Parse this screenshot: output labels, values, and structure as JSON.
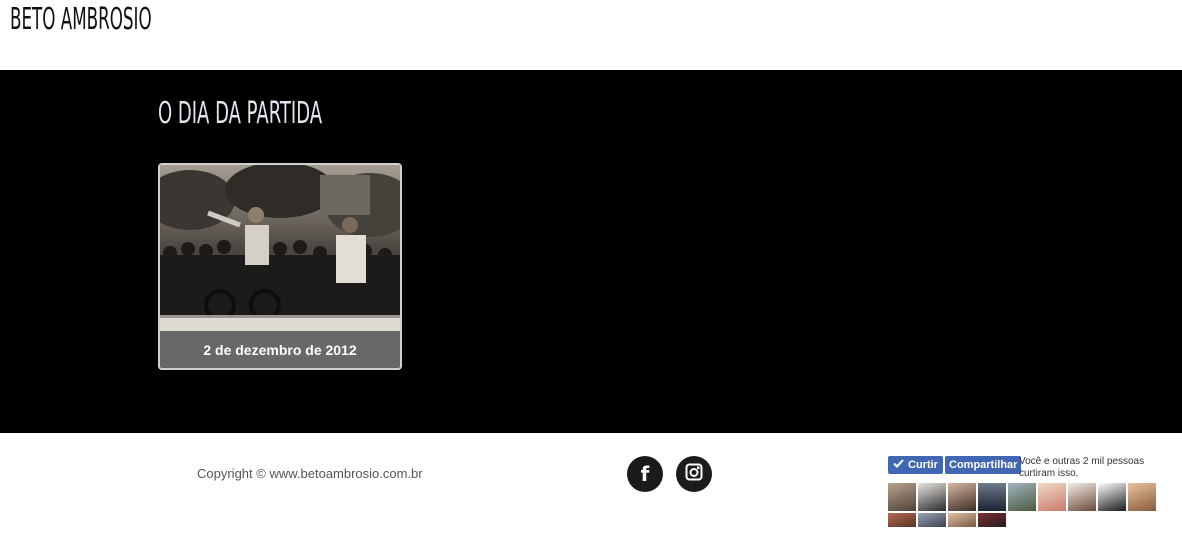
{
  "header": {
    "logo": "BETO AMBROSIO"
  },
  "main": {
    "title": "O DIA DA PARTIDA",
    "gallery": [
      {
        "caption": "2 de dezembro de 2012"
      }
    ]
  },
  "footer": {
    "copyright": "Copyright © www.betoambrosio.com.br",
    "social": [
      {
        "icon": "facebook-icon",
        "glyph": "f"
      },
      {
        "icon": "instagram-icon"
      }
    ],
    "facebook_widget": {
      "like_label": "Curtir",
      "share_label": "Compartilhar",
      "count_text": "Você e outras 2 mil pessoas curtiram isso."
    }
  },
  "colors": {
    "main_background": "#000000",
    "title_color": "#e7e3ef",
    "facebook_blue": "#4267b2",
    "social_circle": "#1b1b1b"
  }
}
